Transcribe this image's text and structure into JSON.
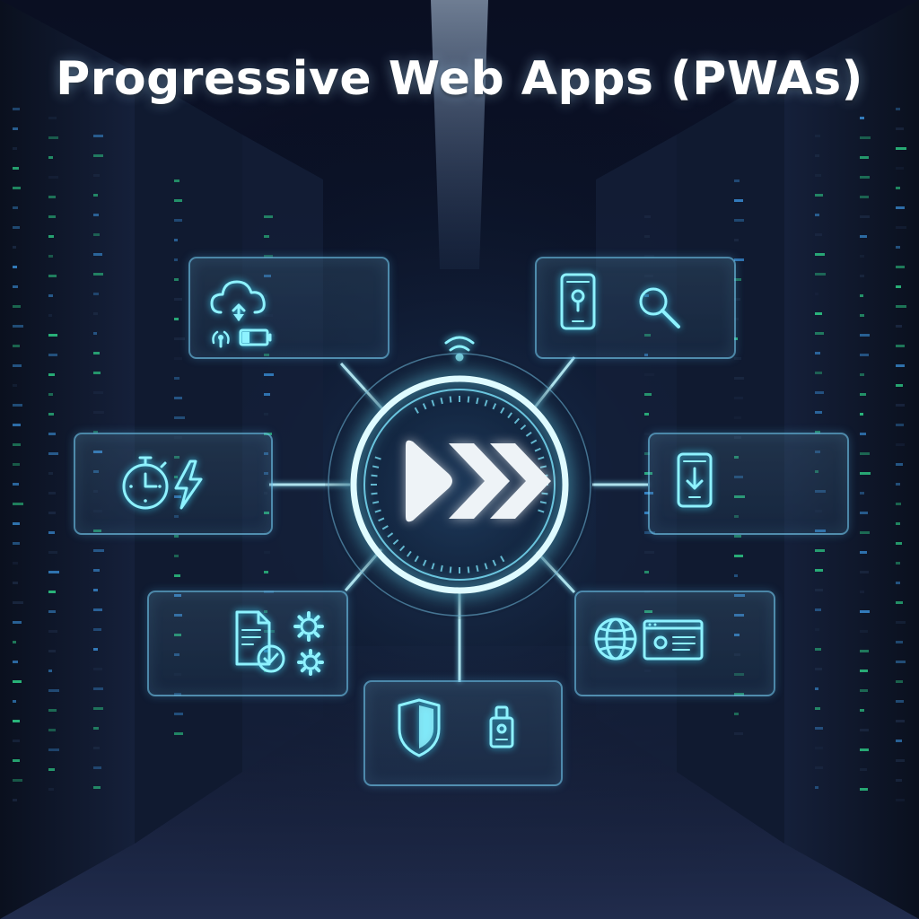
{
  "title": "Progressive Web Apps (PWAs)",
  "colors": {
    "background": "#070b16",
    "accent": "#8ef2ff",
    "panel_border": "#78d7ff",
    "hub_glow": "#aef6ff"
  },
  "hub": {
    "icon": "fast-forward-icon"
  },
  "panels": [
    {
      "id": "offline-sync",
      "icons": [
        "cloud-upload-icon",
        "wireless-signal-icon",
        "battery-icon"
      ]
    },
    {
      "id": "discoverable",
      "icons": [
        "phone-lock-icon",
        "search-icon"
      ]
    },
    {
      "id": "fast",
      "icons": [
        "stopwatch-icon",
        "lightning-icon"
      ]
    },
    {
      "id": "installable",
      "icons": [
        "phone-download-icon"
      ]
    },
    {
      "id": "automation",
      "icons": [
        "document-check-icon",
        "gear-icon",
        "gear-icon"
      ]
    },
    {
      "id": "web-platform",
      "icons": [
        "globe-icon",
        "browser-window-icon"
      ]
    },
    {
      "id": "secure",
      "icons": [
        "shield-icon",
        "usb-key-icon"
      ]
    }
  ]
}
